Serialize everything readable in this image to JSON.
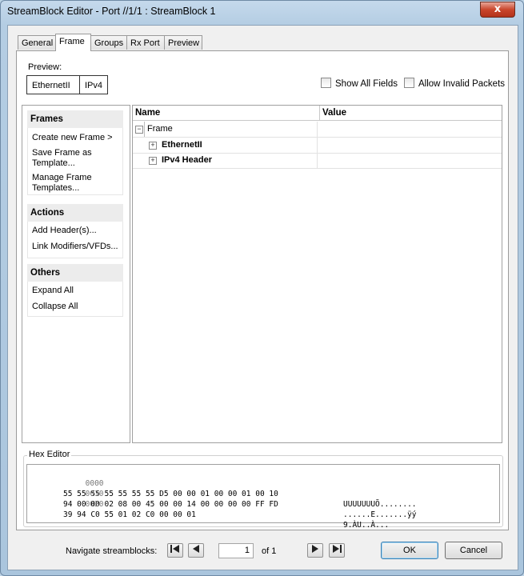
{
  "window": {
    "title": "StreamBlock Editor - Port //1/1 : StreamBlock 1",
    "close_label": "x"
  },
  "tabs": [
    {
      "label": "General"
    },
    {
      "label": "Frame"
    },
    {
      "label": "Groups"
    },
    {
      "label": "Rx Port"
    },
    {
      "label": "Preview"
    }
  ],
  "preview": {
    "label": "Preview:",
    "chips": [
      "EthernetII",
      "IPv4"
    ]
  },
  "options": {
    "show_all_fields": "Show All Fields",
    "allow_invalid_packets": "Allow Invalid Packets"
  },
  "sidebar": {
    "frames": {
      "title": "Frames",
      "items": [
        "Create new Frame >",
        "Save Frame as Template...",
        "Manage Frame Templates..."
      ]
    },
    "actions": {
      "title": "Actions",
      "items": [
        "Add Header(s)...",
        "Link Modifiers/VFDs..."
      ]
    },
    "others": {
      "title": "Others",
      "items": [
        "Expand All",
        "Collapse All"
      ]
    }
  },
  "tree": {
    "columns": {
      "name": "Name",
      "value": "Value"
    },
    "rows": [
      {
        "label": "Frame",
        "expander": "−"
      },
      {
        "label": "EthernetII",
        "expander": "+"
      },
      {
        "label": "IPv4 Header",
        "expander": "+"
      }
    ]
  },
  "hex": {
    "title": "Hex Editor",
    "lines": [
      {
        "offset": "0000",
        "bytes": "55 55 55 55 55 55 55 D5 00 00 01 00 00 01 00 10",
        "ascii": "UUUUUUUÕ........"
      },
      {
        "offset": "0010",
        "bytes": "94 00 00 02 08 00 45 00 00 14 00 00 00 00 FF FD",
        "ascii": "......E.......ÿý"
      },
      {
        "offset": "0020",
        "bytes": "39 94 C0 55 01 02 C0 00 00 01",
        "ascii": "9.ÀU..À..."
      }
    ]
  },
  "footer": {
    "navigate_label": "Navigate streamblocks:",
    "page_value": "1",
    "of_label": "of 1",
    "ok_label": "OK",
    "cancel_label": "Cancel"
  }
}
